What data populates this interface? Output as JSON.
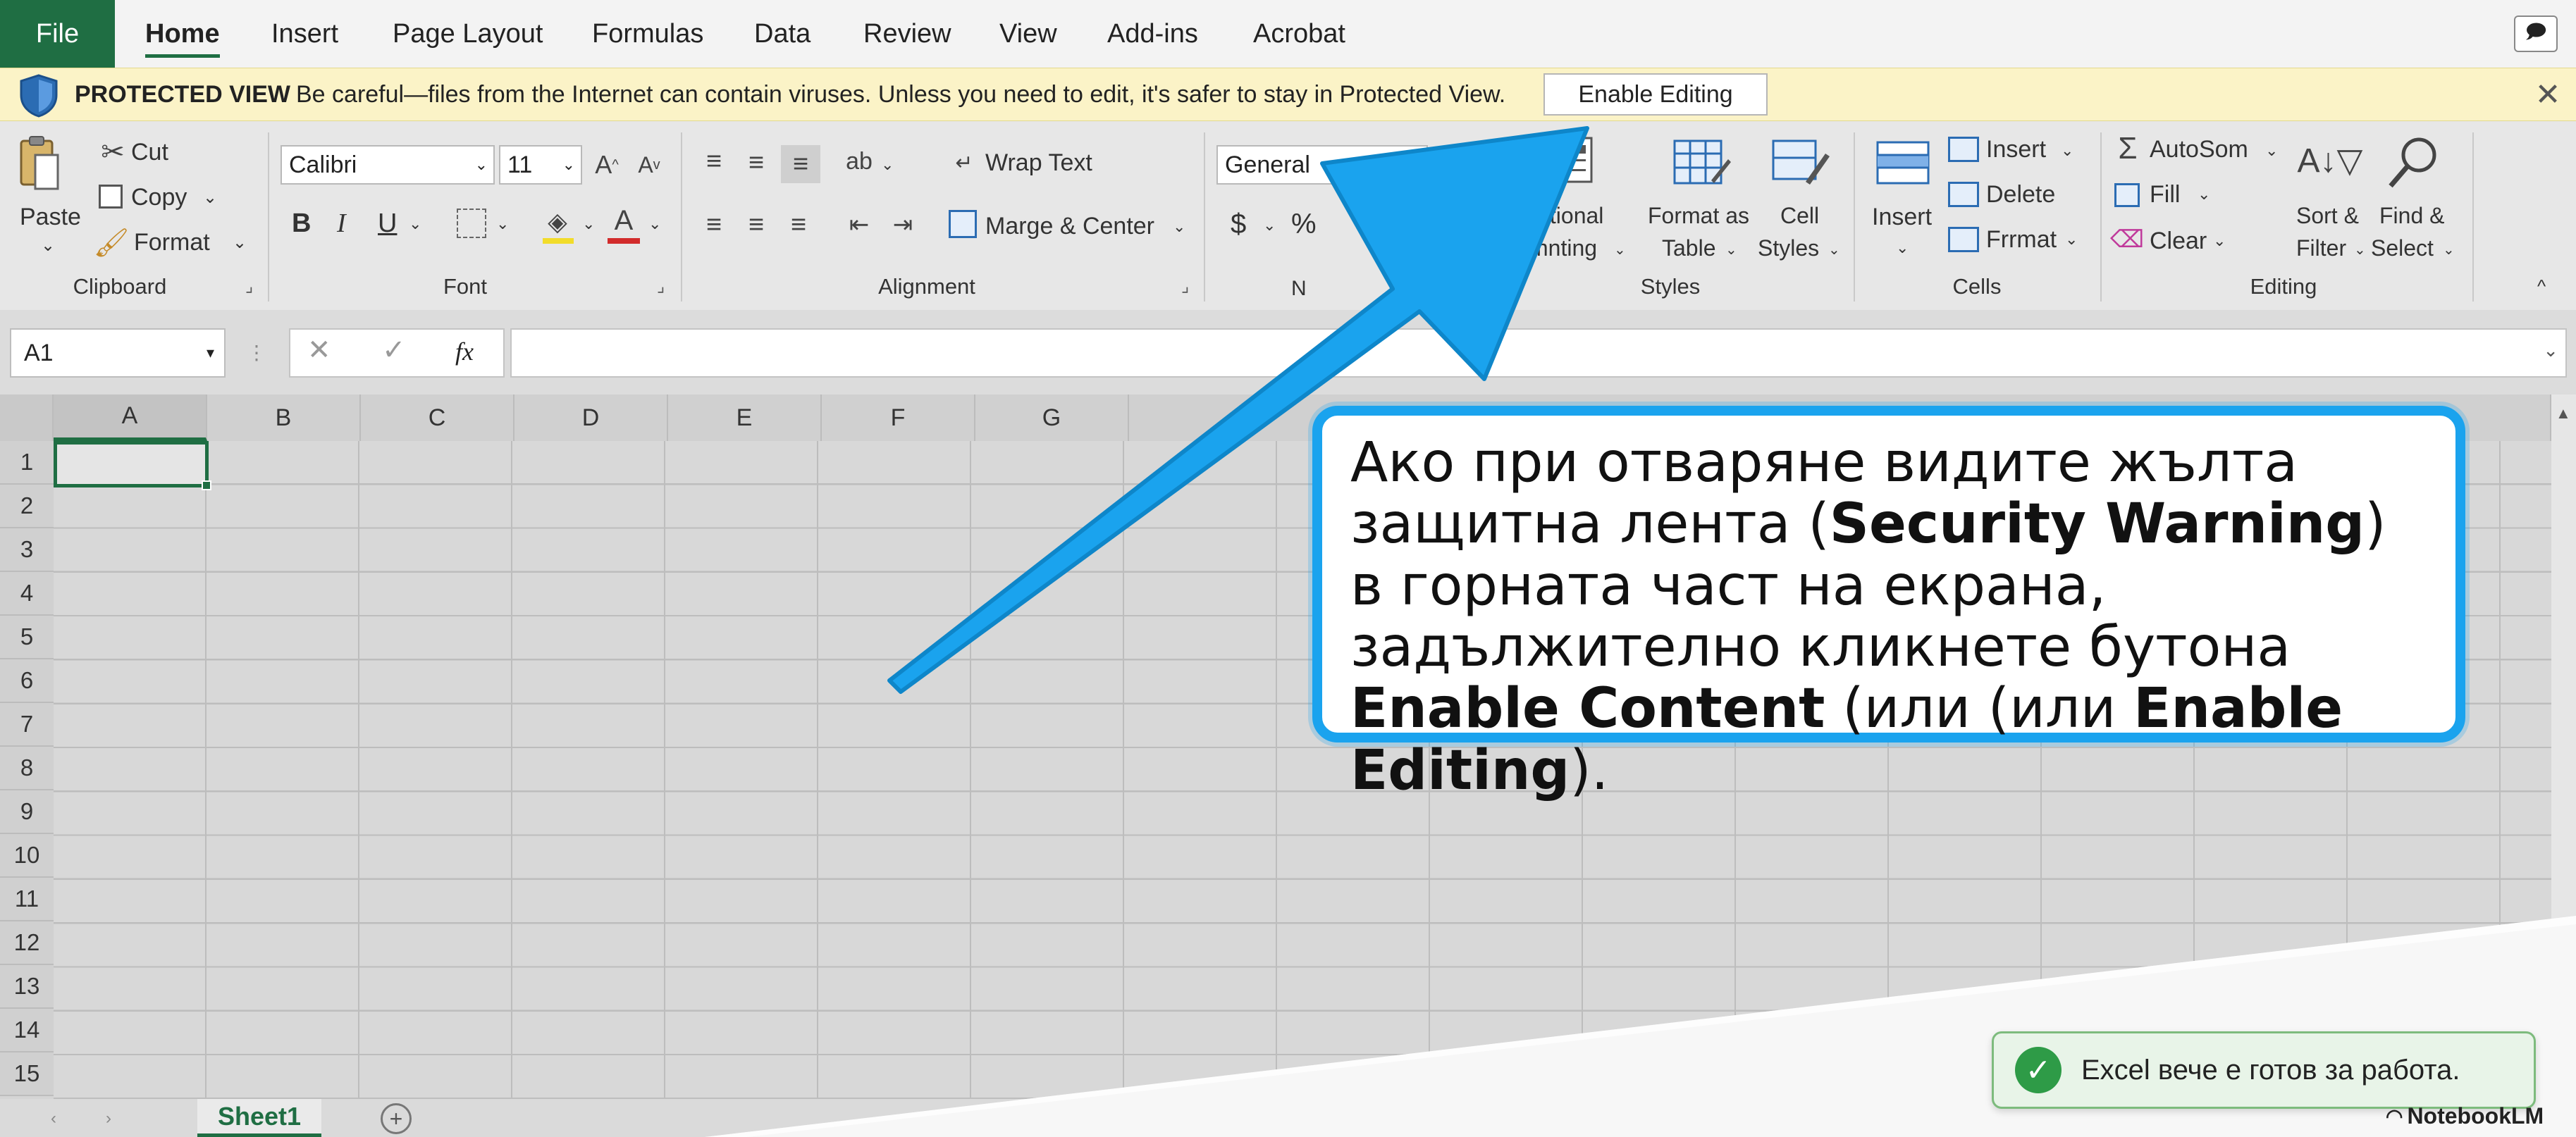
{
  "menu": {
    "file": "File",
    "tabs": [
      {
        "label": "Home"
      },
      {
        "label": "Insert"
      },
      {
        "label": "Page Layout"
      },
      {
        "label": "Formulas"
      },
      {
        "label": "Data"
      },
      {
        "label": "Review"
      },
      {
        "label": "View"
      },
      {
        "label": "Add-ins"
      },
      {
        "label": "Acrobat"
      }
    ],
    "active_tab": "Home"
  },
  "protected_view": {
    "title": "PROTECTED VIEW",
    "message": "Be careful—files from the Internet can contain viruses. Unless you need to edit, it's safer to stay in Protected View.",
    "button": "Enable Editing",
    "close": "✕",
    "bar_color": "#fbf3c7"
  },
  "ribbon": {
    "clipboard": {
      "paste": "Paste",
      "cut": "Cut",
      "copy": "Copy",
      "format": "Format",
      "label": "Clipboard"
    },
    "font": {
      "name": "Calibri",
      "size": "11",
      "bold": "B",
      "italic": "I",
      "underline": "U",
      "label": "Font"
    },
    "alignment": {
      "wrap": "Wrap Text",
      "merge": "Marge & Center",
      "label": "Alignment"
    },
    "number": {
      "format": "General",
      "currency": "$",
      "percent": "%"
    },
    "styles": {
      "conditional_line1": "ditional",
      "conditional_line2": "mnting",
      "format_table_line1": "Format as",
      "format_table_line2": "Table",
      "cell_styles_line1": "Cell",
      "cell_styles_line2": "Styles",
      "label": "Styles"
    },
    "cells": {
      "insert": "Insert",
      "insert_btn": "Insert",
      "delete": "Delete",
      "format": "Frrmat",
      "label": "Cells"
    },
    "editing": {
      "autosum": "AutoSom",
      "fill": "Fill",
      "clear": "Clear",
      "sort_line1": "Sort &",
      "sort_line2": "Filter",
      "find_line1": "Find &",
      "find_line2": "Select",
      "label": "Editing"
    }
  },
  "formula_bar": {
    "name_box": "A1",
    "fx": "fx"
  },
  "grid": {
    "columns": [
      "A",
      "B",
      "C",
      "D",
      "E",
      "F",
      "G"
    ],
    "rows": [
      "1",
      "2",
      "3",
      "4",
      "5",
      "6",
      "7",
      "8",
      "9",
      "10",
      "11",
      "12",
      "13",
      "14",
      "15"
    ],
    "selected_cell": "A1"
  },
  "sheets": {
    "active": "Sheet1"
  },
  "callout": {
    "part1": "Ако при отваряне видите жълта защитна лента (",
    "bold1": "Security Warning",
    "part2": ") в горната част на екрана, задължително кликнете бутона ",
    "bold2": "Enable Content",
    "part3": " (или (или ",
    "bold3": "Enable Editing",
    "part4": ").",
    "border_color": "#1aa3ee"
  },
  "toast": {
    "text": "Excel вече е готов за работа.",
    "icon": "check-icon",
    "color": "#2e9b47"
  },
  "watermark": {
    "text": "NotebookLM"
  },
  "colors": {
    "excel_green": "#1f6e43",
    "arrow_blue": "#1aa3ee"
  }
}
